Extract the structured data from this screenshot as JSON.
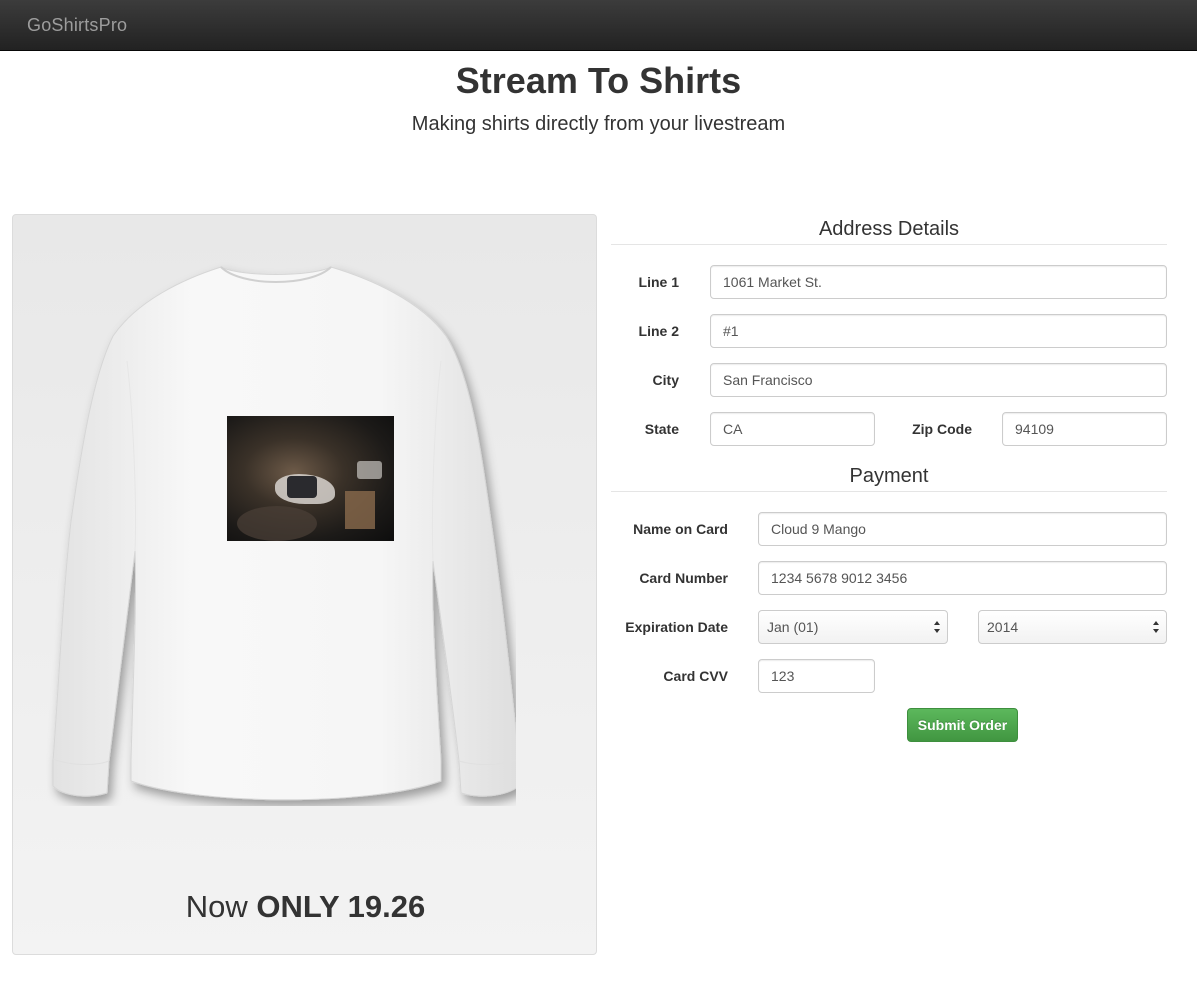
{
  "navbar": {
    "brand": "GoShirtsPro"
  },
  "hero": {
    "title": "Stream To Shirts",
    "subtitle": "Making shirts directly from your livestream"
  },
  "product": {
    "price_prefix": "Now",
    "price_text": "ONLY 19.26"
  },
  "address": {
    "heading": "Address Details",
    "line1": {
      "label": "Line 1",
      "value": "1061 Market St."
    },
    "line2": {
      "label": "Line 2",
      "value": "#1"
    },
    "city": {
      "label": "City",
      "value": "San Francisco"
    },
    "state": {
      "label": "State",
      "value": "CA"
    },
    "zip": {
      "label": "Zip Code",
      "value": "94109"
    }
  },
  "payment": {
    "heading": "Payment",
    "name": {
      "label": "Name on Card",
      "value": "Cloud 9 Mango"
    },
    "number": {
      "label": "Card Number",
      "value": "1234 5678 9012 3456"
    },
    "expiration": {
      "label": "Expiration Date",
      "month": "Jan (01)",
      "year": "2014"
    },
    "cvv": {
      "label": "Card CVV",
      "value": "123"
    },
    "submit_label": "Submit Order"
  },
  "colors": {
    "navbar": "#222222",
    "brand": "#9d9d9d",
    "submit": "#5cb85c"
  }
}
